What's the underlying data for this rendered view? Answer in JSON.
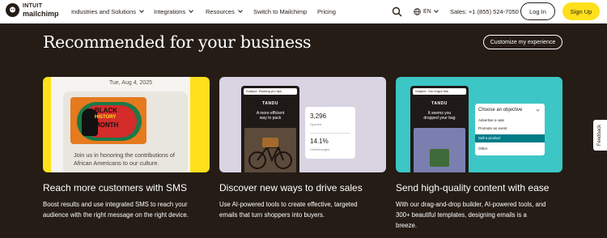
{
  "nav": {
    "logo_top": "INTUIT",
    "logo_bottom": "mailchimp",
    "items": [
      {
        "label": "Industries and Solutions"
      },
      {
        "label": "Integrations"
      },
      {
        "label": "Resources"
      },
      {
        "label": "Switch to Mailchimp"
      },
      {
        "label": "Pricing"
      }
    ],
    "language": "EN",
    "sales": "Sales: +1 (855) 524-7050",
    "login": "Log In",
    "signup": "Sign Up"
  },
  "header": {
    "title": "Recommended for your business",
    "customize_button": "Customize my experience"
  },
  "cards": [
    {
      "title": "Reach more customers with SMS",
      "desc_line1": "Boost results and use integrated SMS to reach your",
      "desc_line2": "audience with the right message on the right device.",
      "image": {
        "date": "Tue, Aug 4, 2025",
        "poster_line1": "BLACK",
        "poster_line2": "HISTORY",
        "poster_line3": "MONTH",
        "msg_line1": "Join us in honoring the contributions of",
        "msg_line2": "African Americans to our culture."
      }
    },
    {
      "title": "Discover new ways to drive sales",
      "desc_line1": "Use AI-powered tools to create effective, targeted",
      "desc_line2": "emails that turn shoppers into buyers.",
      "image": {
        "subject": "Subject: Packing pro tips",
        "brand": "TANDU",
        "headline_line1": "A more efficient",
        "headline_line2": "way to pack",
        "stat1_value": "3,296",
        "stat1_label": "Opened",
        "stat2_value": "14.1%",
        "stat2_label": "Clickthroughs"
      }
    },
    {
      "title": "Send high-quality content with ease",
      "desc_line1": "With our drag-and-drop builder, AI-powered tools, and",
      "desc_line2": "300+ beautiful templates, designing emails is a",
      "desc_line3": "breeze.",
      "image": {
        "subject": "Subject: You forgot this",
        "brand": "TANDU",
        "headline_line1": "It seems you",
        "headline_line2": "dropped your bag",
        "dropdown_title": "Choose an objective",
        "options": [
          "Advertise a sale",
          "Promote an event",
          "Sell a product",
          "Other"
        ],
        "selected_index": 2
      }
    }
  ],
  "feedback": "Feedback",
  "colors": {
    "page_bg": "#241c15",
    "brand_yellow": "#ffe01b",
    "card2_bg": "#d9d3e2",
    "card3_bg": "#3cc6c5",
    "selected_option": "#007c89"
  }
}
